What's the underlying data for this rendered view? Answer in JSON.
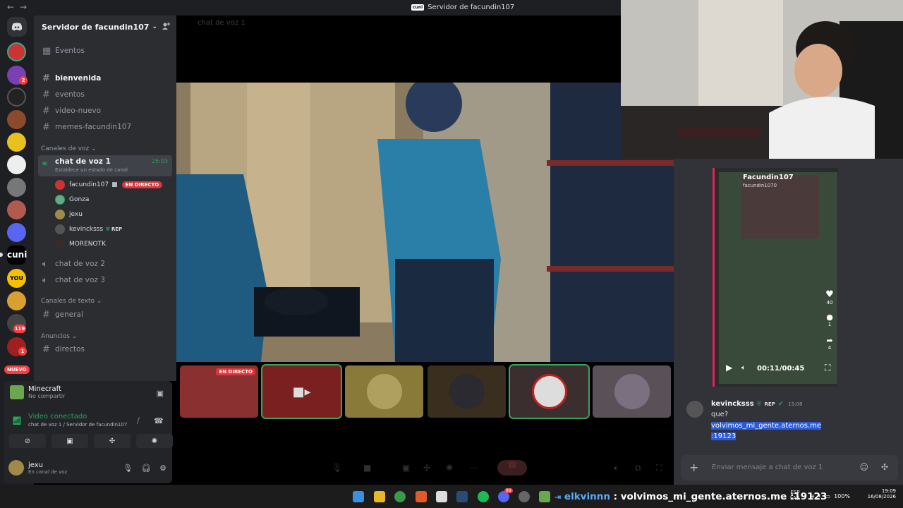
{
  "window": {
    "title": "Servidor de facundin107"
  },
  "rail": {
    "nuevo_label": "NUEVO",
    "badges": [
      "2",
      "119",
      "1"
    ]
  },
  "server": {
    "name": "Servidor de facundin107"
  },
  "channels": {
    "events_label": "Eventos",
    "text": [
      "bienvenida",
      "eventos",
      "video-nuevo",
      "memes-facundin107"
    ],
    "voice_category": "Canales de voz",
    "active_voice": {
      "name": "chat de voz 1",
      "status": "Establece un estado de canal",
      "timer": "25:03"
    },
    "voice_users": [
      {
        "name": "facundin107",
        "badge": "EN DIRECTO"
      },
      {
        "name": "Gonza"
      },
      {
        "name": "jexu"
      },
      {
        "name": "kevincksss",
        "badge": "REP"
      },
      {
        "name": "MORENOTK"
      }
    ],
    "other_voice": [
      "chat de voz 2",
      "chat de voz 3"
    ],
    "text_category": "Canales de texto",
    "text2": [
      "general"
    ],
    "announce_category": "Anuncios",
    "announce": [
      "directos"
    ]
  },
  "activity": {
    "game": "Minecraft",
    "share": "No compartir"
  },
  "voice_conn": {
    "status": "Video conectado",
    "detail": "chat de voz 1 / Servidor de facundin107"
  },
  "user": {
    "name": "jexu",
    "status": "En canal de voz"
  },
  "stage": {
    "channel_label": "chat de voz 1",
    "live_label": "EN DIRECTO"
  },
  "chat": {
    "message": {
      "author": "kevincksss",
      "tag": "REP",
      "time": "19:08",
      "lines": [
        "que?",
        "volvimos_mi_gente.aternos.me",
        ":19123"
      ]
    },
    "placeholder": "Enviar mensaje a chat de voz 1"
  },
  "tiktok": {
    "user": "Facundin107",
    "handle": "facundin1070",
    "likes": "40",
    "comments": "1",
    "shares": "4",
    "time": "00:11/00:45"
  },
  "taskbar": {
    "marquee_name": "elkvinnn",
    "marquee_text": ": volvimos_mi_gente.aternos.me :19123",
    "lang1": "ESP",
    "lang2": "LAA",
    "battery": "100%",
    "time": "19:09",
    "date": "16/08/2026",
    "discord_badge": "99"
  }
}
